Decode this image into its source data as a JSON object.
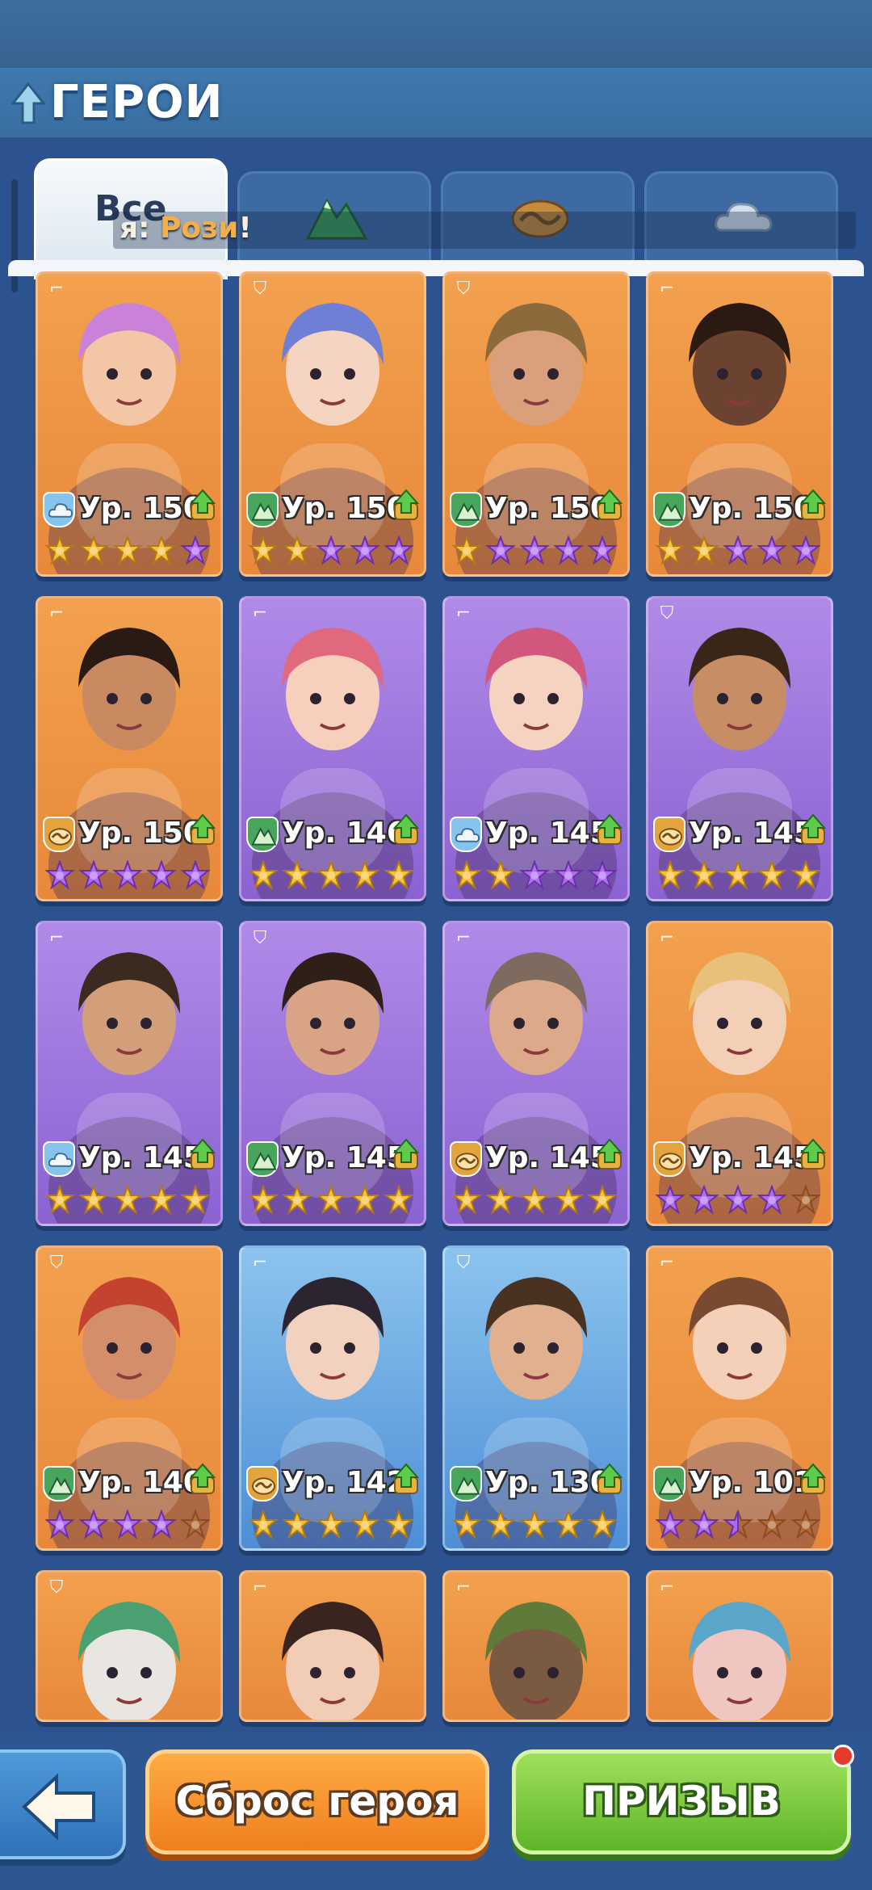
{
  "header": {
    "title": "ГЕРОИ"
  },
  "tabs": [
    {
      "label": "Все",
      "icon": "all",
      "active": true
    },
    {
      "label": "",
      "icon": "mountain-icon",
      "color": "#3a9a57"
    },
    {
      "label": "",
      "icon": "wave-icon",
      "color": "#c58a3a"
    },
    {
      "label": "",
      "icon": "cloud-icon",
      "color": "#c8d6e6"
    }
  ],
  "ticker": {
    "prefix": "я: ",
    "name": "Рози",
    "suffix": "!"
  },
  "cards": [
    {
      "level": "Ур. 150",
      "class": "cloud",
      "role": "gun",
      "bg": "orange",
      "stars": [
        "g",
        "g",
        "g",
        "g",
        "p"
      ],
      "skin": "#f3c6a6",
      "hair": "#c982d8"
    },
    {
      "level": "Ур. 150",
      "class": "mountain",
      "role": "shield",
      "bg": "orange",
      "stars": [
        "g",
        "g",
        "p",
        "p",
        "p"
      ],
      "skin": "#f6d4c2",
      "hair": "#6f7fd6"
    },
    {
      "level": "Ур. 150",
      "class": "mountain",
      "role": "shield",
      "bg": "orange",
      "stars": [
        "g",
        "p",
        "p",
        "p",
        "p"
      ],
      "skin": "#d9a07b",
      "hair": "#8c6a3c"
    },
    {
      "level": "Ур. 150",
      "class": "mountain",
      "role": "gun",
      "bg": "orange",
      "stars": [
        "g",
        "g",
        "p",
        "p",
        "p"
      ],
      "skin": "#6b4330",
      "hair": "#2a1a12"
    },
    {
      "level": "Ур. 150",
      "class": "wave",
      "role": "gun",
      "bg": "orange",
      "stars": [
        "p",
        "p",
        "p",
        "p",
        "p"
      ],
      "skin": "#c98a62",
      "hair": "#2a1a14"
    },
    {
      "level": "Ур. 146",
      "class": "mountain",
      "role": "gun",
      "bg": "purple",
      "stars": [
        "g",
        "g",
        "g",
        "g",
        "g"
      ],
      "skin": "#f6d0bd",
      "hair": "#e0697e"
    },
    {
      "level": "Ур. 145",
      "class": "cloud",
      "role": "gun",
      "bg": "purple",
      "stars": [
        "g",
        "g",
        "p",
        "p",
        "p"
      ],
      "skin": "#f6d2c0",
      "hair": "#d2577c"
    },
    {
      "level": "Ур. 145",
      "class": "wave",
      "role": "shield",
      "bg": "purple",
      "stars": [
        "g",
        "g",
        "g",
        "g",
        "g"
      ],
      "skin": "#c78e66",
      "hair": "#3a2618"
    },
    {
      "level": "Ур. 145",
      "class": "cloud",
      "role": "gun",
      "bg": "purple",
      "stars": [
        "g",
        "g",
        "g",
        "g",
        "g"
      ],
      "skin": "#d39e7a",
      "hair": "#3a2a20"
    },
    {
      "level": "Ур. 145",
      "class": "mountain",
      "role": "shield",
      "bg": "purple",
      "stars": [
        "g",
        "g",
        "g",
        "g",
        "g"
      ],
      "skin": "#d9a486",
      "hair": "#2e2018"
    },
    {
      "level": "Ур. 145",
      "class": "wave",
      "role": "gun",
      "bg": "purple",
      "stars": [
        "g",
        "g",
        "g",
        "g",
        "g"
      ],
      "skin": "#dca98a",
      "hair": "#7e6a5e"
    },
    {
      "level": "Ур. 145",
      "class": "wave",
      "role": "gun",
      "bg": "orange",
      "stars": [
        "p",
        "p",
        "p",
        "p",
        "e"
      ],
      "skin": "#f3cfb6",
      "hair": "#e8c07a"
    },
    {
      "level": "Ур. 140",
      "class": "mountain",
      "role": "shield",
      "bg": "orange",
      "stars": [
        "p",
        "p",
        "p",
        "p",
        "e"
      ],
      "skin": "#d48f6a",
      "hair": "#c4432e"
    },
    {
      "level": "Ур. 142",
      "class": "wave",
      "role": "gun",
      "bg": "blue",
      "stars": [
        "g",
        "g",
        "g",
        "g",
        "g"
      ],
      "skin": "#f2d2bf",
      "hair": "#2c2430"
    },
    {
      "level": "Ур. 130",
      "class": "mountain",
      "role": "shield",
      "bg": "blue",
      "stars": [
        "g",
        "g",
        "g",
        "g",
        "g"
      ],
      "skin": "#e1b08e",
      "hair": "#4a3222"
    },
    {
      "level": "Ур. 101",
      "class": "mountain",
      "role": "gun",
      "bg": "orange",
      "stars": [
        "p",
        "p",
        "h",
        "e",
        "e"
      ],
      "skin": "#f4d0b8",
      "hair": "#7a4a30"
    },
    {
      "level": "",
      "class": "",
      "role": "shield",
      "bg": "orange",
      "stars": [],
      "skin": "#e9e6e2",
      "hair": "#4aa070"
    },
    {
      "level": "",
      "class": "",
      "role": "gun",
      "bg": "orange",
      "stars": [],
      "skin": "#f1cdb6",
      "hair": "#3a2420"
    },
    {
      "level": "",
      "class": "",
      "role": "gun",
      "bg": "orange",
      "stars": [],
      "skin": "#7a5a40",
      "hair": "#5f7a3a"
    },
    {
      "level": "",
      "class": "",
      "role": "gun",
      "bg": "orange",
      "stars": [],
      "skin": "#f0c6c0",
      "hair": "#5aa6c8"
    }
  ],
  "footer": {
    "back_label": "назад",
    "reset_label": "Сброс героя",
    "summon_label": "ПРИЗЫВ"
  },
  "colors": {
    "orange_card": "#ee8f40",
    "purple_card": "#9b72dc",
    "blue_card": "#6aa6e2",
    "gold_star": "#f5c23c",
    "purple_star": "#b06cf0"
  }
}
